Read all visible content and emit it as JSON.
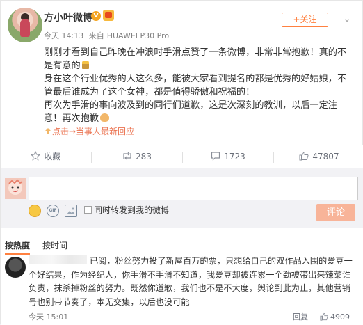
{
  "post": {
    "username": "方小叶微博",
    "verified_badge": "V",
    "meta": {
      "date": "今天 14:13",
      "source_prefix": "来自",
      "device": "HUAWEI P30 Pro"
    },
    "follow_label": "+关注",
    "paragraphs": [
      "刚刚才看到自己昨晚在冲浪时手滑点赞了一条微博，非常非常抱歉！真的不是有意的",
      "身在这个行业优秀的人这么多，能被大家看到提名的都是优秀的好姑娘，不管最后谁成为了这个女神，都是值得骄傲和祝福的！",
      "再次为手滑的事向波及到的同行们道歉，这是次深刻的教训，以后一定注意！再次抱歉"
    ],
    "reply_link": "点击→当事人最新回应"
  },
  "actions": {
    "favorite": "收藏",
    "repost_count": "283",
    "comment_count": "1723",
    "like_count": "47807"
  },
  "composer": {
    "forward_label": "同时转发到我的微博",
    "submit_label": "评论"
  },
  "sort": {
    "hot": "按热度",
    "time": "按时间"
  },
  "comment": {
    "text": "已阅，粉丝努力投了新屋百万的票，只想给自己的双作品入围的爱豆一个好结果，作为经纪人，你手滑不手滑不知道，我爱豆却被连累一个劲被带出来辣菜谁负责，抹杀掉粉丝的努力。既然你道歉，我们也不是不大度，舆论到此为止，其他营销号也别带节奏了，本无交集，以后也没可能",
    "time": "今天 15:01",
    "reply_label": "回复",
    "like_count": "4909"
  },
  "colors": {
    "accent": "#ff8140",
    "link": "#eb7350"
  }
}
